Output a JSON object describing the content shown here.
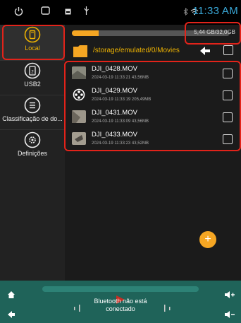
{
  "status": {
    "time": "11:33 AM",
    "icons": [
      "power-icon",
      "window-icon",
      "image-icon",
      "usb-icon",
      "bluetooth-icon",
      "wifi-icon"
    ]
  },
  "sidebar": {
    "items": [
      {
        "label": "Local",
        "icon": "phone-storage-icon",
        "active": true
      },
      {
        "label": "USB2",
        "icon": "usb-drive-icon",
        "active": false
      },
      {
        "label": "Classificação de do...",
        "icon": "list-icon",
        "active": false
      },
      {
        "label": "Definições",
        "icon": "settings-icon",
        "active": false
      }
    ]
  },
  "storage": {
    "text": "5,44 GB/32,0GB",
    "used_fraction": 0.17
  },
  "path": {
    "text": "/storage/emulated/0/Movies"
  },
  "files": [
    {
      "name": "DJI_0428.MOV",
      "meta": "2024-03-19 11:33:21  43,56MB",
      "thumb": "video-thumbnail"
    },
    {
      "name": "DJI_0429.MOV",
      "meta": "2024-03-19 11:33:19  205,49MB",
      "thumb": "film-reel-icon"
    },
    {
      "name": "DJI_0431.MOV",
      "meta": "2024-03-19 11:33:09  43,56MB",
      "thumb": "video-thumbnail"
    },
    {
      "name": "DJI_0433.MOV",
      "meta": "2024-03-19 11:33:23  43,52MB",
      "thumb": "video-thumbnail"
    }
  ],
  "fab": {
    "label": "+"
  },
  "bottom": {
    "bt_status": "Bluetooth não está conectado"
  },
  "colors": {
    "accent": "#f5a623",
    "highlight": "#e2231a",
    "bottom_bar": "#1f6359",
    "time": "#3aa8d8"
  }
}
